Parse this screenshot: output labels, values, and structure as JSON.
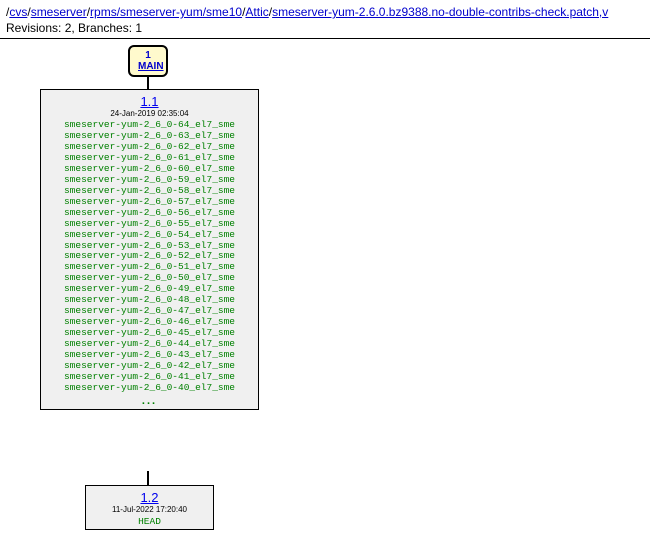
{
  "header": {
    "seg1": "/",
    "seg2": "cvs",
    "seg3": "/",
    "seg4": "smeserver",
    "seg5": "/",
    "seg6": "rpms/smeserver-yum/sme10",
    "seg7": "/",
    "seg8": "Attic",
    "seg9": "/",
    "seg10": "smeserver-yum-2.6.0.bz9388.no-double-contribs-check.patch,v",
    "rev_line": "Revisions: 2, Branches: 1"
  },
  "branch": {
    "number": "1",
    "name": "MAIN"
  },
  "rev1": {
    "number": "1.1",
    "date": "24-Jan-2019 02:35:04",
    "tags": [
      "smeserver-yum-2_6_0-64_el7_sme",
      "smeserver-yum-2_6_0-63_el7_sme",
      "smeserver-yum-2_6_0-62_el7_sme",
      "smeserver-yum-2_6_0-61_el7_sme",
      "smeserver-yum-2_6_0-60_el7_sme",
      "smeserver-yum-2_6_0-59_el7_sme",
      "smeserver-yum-2_6_0-58_el7_sme",
      "smeserver-yum-2_6_0-57_el7_sme",
      "smeserver-yum-2_6_0-56_el7_sme",
      "smeserver-yum-2_6_0-55_el7_sme",
      "smeserver-yum-2_6_0-54_el7_sme",
      "smeserver-yum-2_6_0-53_el7_sme",
      "smeserver-yum-2_6_0-52_el7_sme",
      "smeserver-yum-2_6_0-51_el7_sme",
      "smeserver-yum-2_6_0-50_el7_sme",
      "smeserver-yum-2_6_0-49_el7_sme",
      "smeserver-yum-2_6_0-48_el7_sme",
      "smeserver-yum-2_6_0-47_el7_sme",
      "smeserver-yum-2_6_0-46_el7_sme",
      "smeserver-yum-2_6_0-45_el7_sme",
      "smeserver-yum-2_6_0-44_el7_sme",
      "smeserver-yum-2_6_0-43_el7_sme",
      "smeserver-yum-2_6_0-42_el7_sme",
      "smeserver-yum-2_6_0-41_el7_sme",
      "smeserver-yum-2_6_0-40_el7_sme"
    ],
    "ellipsis": "..."
  },
  "rev2": {
    "number": "1.2",
    "date": "11-Jul-2022 17:20:40",
    "head": "HEAD"
  }
}
